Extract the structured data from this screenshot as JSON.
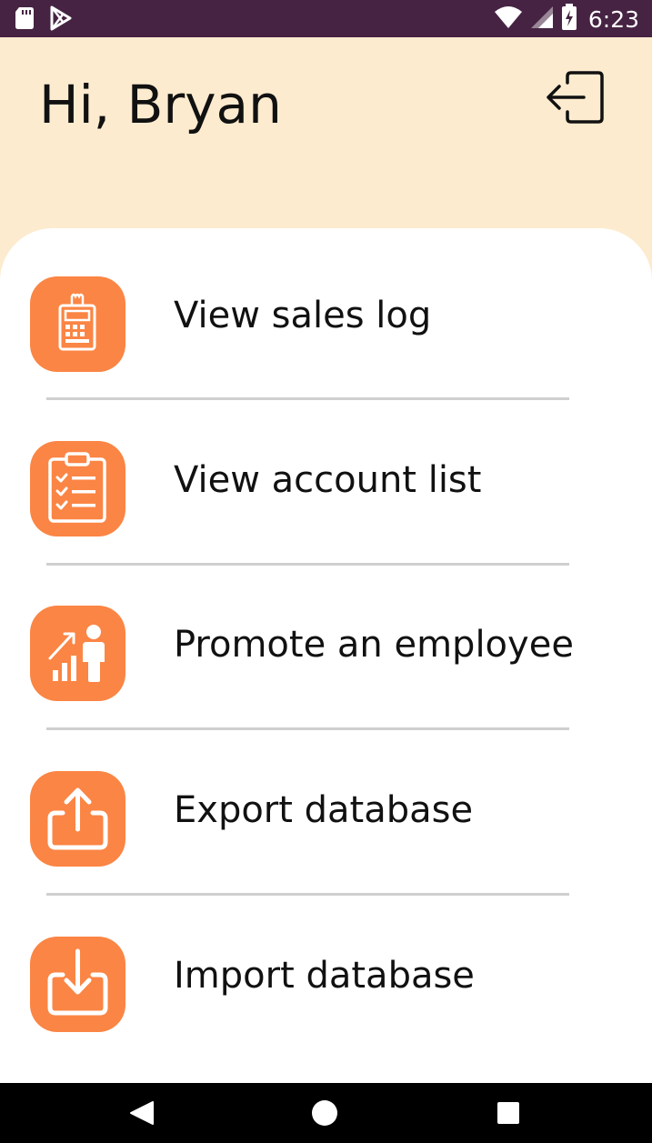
{
  "status_bar": {
    "time": "6:23",
    "icons": [
      "sd-card-icon",
      "play-store-icon",
      "wifi-icon",
      "signal-icon",
      "battery-charging-icon"
    ]
  },
  "header": {
    "greeting": "Hi, Bryan",
    "logout_icon": "logout-icon"
  },
  "menu": {
    "items": [
      {
        "label": "View sales log",
        "icon": "cash-register-icon"
      },
      {
        "label": "View account list",
        "icon": "checklist-icon"
      },
      {
        "label": "Promote an employee",
        "icon": "employee-growth-icon"
      },
      {
        "label": "Export database",
        "icon": "export-icon"
      },
      {
        "label": "Import database",
        "icon": "import-icon"
      }
    ]
  },
  "nav_bar": {
    "buttons": [
      "back-icon",
      "home-icon",
      "recents-icon"
    ]
  },
  "colors": {
    "status_bar": "#462343",
    "header_bg": "#fdebcf",
    "accent": "#fb8544",
    "divider": "#cfcfcf",
    "text": "#111111"
  }
}
